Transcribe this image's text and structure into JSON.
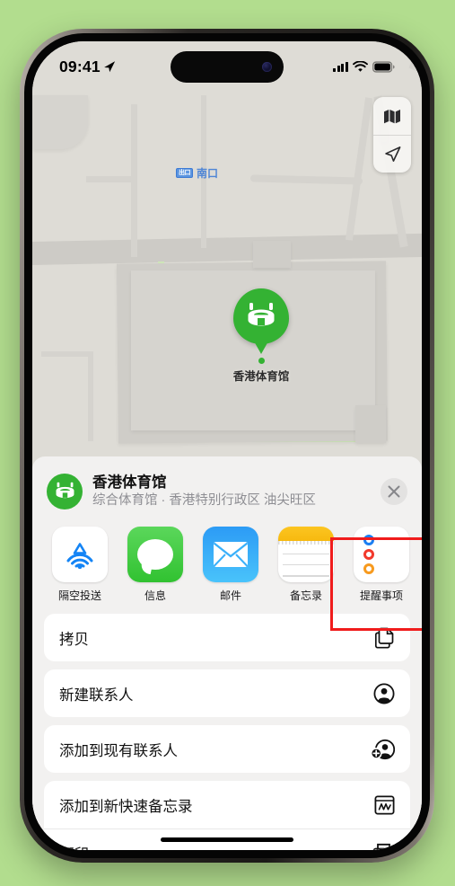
{
  "statusbar": {
    "time": "09:41",
    "location_arrow_icon": "location-arrow-icon",
    "cellular_icon": "cellular-bars-icon",
    "wifi_icon": "wifi-icon",
    "battery_icon": "battery-icon"
  },
  "map": {
    "transit_label": "南口",
    "transit_badge": "出口",
    "pin_label": "香港体育馆",
    "pin_icon": "stadium-icon",
    "controls": [
      {
        "name": "map-layers-icon"
      },
      {
        "name": "location-arrow-icon"
      }
    ]
  },
  "sheet": {
    "title": "香港体育馆",
    "subtitle": "综合体育馆 · 香港特别行政区 油尖旺区",
    "avatar_icon": "stadium-icon",
    "close_label": "✕",
    "apps": [
      {
        "label": "隔空投送",
        "icon": "airdrop-icon"
      },
      {
        "label": "信息",
        "icon": "messages-icon"
      },
      {
        "label": "邮件",
        "icon": "mail-icon"
      },
      {
        "label": "备忘录",
        "icon": "notes-icon",
        "highlighted": true
      },
      {
        "label": "提醒事项",
        "icon": "reminders-icon"
      }
    ],
    "actions": [
      {
        "label": "拷贝",
        "icon": "copy-icon"
      },
      {
        "label": "新建联系人",
        "icon": "person-circle-icon"
      },
      {
        "label": "添加到现有联系人",
        "icon": "person-add-icon"
      },
      {
        "label": "添加到新快速备忘录",
        "icon": "quick-note-icon"
      },
      {
        "label": "打印",
        "icon": "printer-icon"
      }
    ]
  },
  "colors": {
    "background": "#b2dd8e",
    "accent_green": "#34b233",
    "highlight_red": "#f01c1c",
    "transit_blue": "#4f86d6"
  }
}
